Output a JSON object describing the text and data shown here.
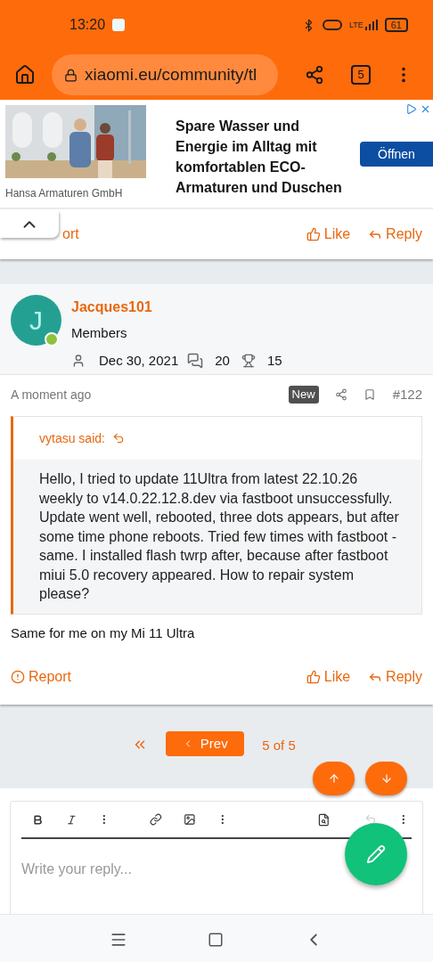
{
  "status_bar": {
    "time": "13:20",
    "battery": "61",
    "network": "LTE"
  },
  "browser": {
    "url": "xiaomi.eu/community/tl",
    "tab_count": "5"
  },
  "ad": {
    "advertiser": "Hansa Armaturen GmbH",
    "headline": "Spare Wasser und Energie im Alltag mit komfortablen ECO-Armaturen und Duschen",
    "button": "Öffnen"
  },
  "previous_post_actions": {
    "report": "ort",
    "like": "Like",
    "reply": "Reply"
  },
  "user": {
    "initial": "J",
    "name": "Jacques101",
    "role": "Members",
    "joined": "Dec 30, 2021",
    "messages": "20",
    "points": "15"
  },
  "post": {
    "time": "A moment ago",
    "badge": "New",
    "number": "#122",
    "quote": {
      "author": "vytasu said:",
      "text": "Hello, I tried to update 11Ultra from latest 22.10.26 weekly to v14.0.22.12.8.dev via fastboot unsuccessfully. Update went well, rebooted, three dots appears, but after some time phone reboots. Tried few times with fastboot - same. I installed flash twrp after, because after fastboot miui 5.0 recovery appeared. How to repair system please?"
    },
    "message": "Same for me on my Mi 11 Ultra",
    "actions": {
      "report": "Report",
      "like": "Like",
      "reply": "Reply"
    }
  },
  "pagination": {
    "prev": "Prev",
    "page": "5 of 5"
  },
  "editor": {
    "placeholder": "Write your reply..."
  }
}
